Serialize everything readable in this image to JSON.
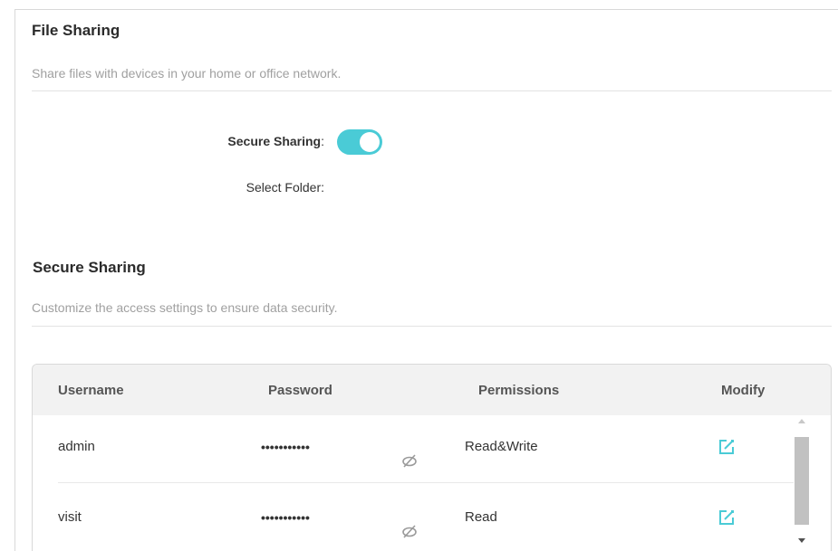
{
  "file_sharing": {
    "title": "File Sharing",
    "description": "Share files with devices in your home or office network.",
    "secure_sharing_label": "Secure Sharing",
    "secure_sharing_colon": ":",
    "secure_sharing_enabled": true,
    "select_folder_label": "Select Folder:"
  },
  "secure_sharing": {
    "title": "Secure Sharing",
    "description": "Customize the access settings to ensure data security."
  },
  "table": {
    "headers": {
      "username": "Username",
      "password": "Password",
      "permissions": "Permissions",
      "modify": "Modify"
    },
    "rows": [
      {
        "username": "admin",
        "password": "•••••••••••",
        "permissions": "Read&Write"
      },
      {
        "username": "visit",
        "password": "•••••••••••",
        "permissions": "Read"
      }
    ]
  },
  "colors": {
    "accent": "#4acbd6",
    "header_bg": "#f2f2f2"
  },
  "icons": {
    "visibility": "eye-hidden-icon",
    "edit": "edit-icon"
  }
}
